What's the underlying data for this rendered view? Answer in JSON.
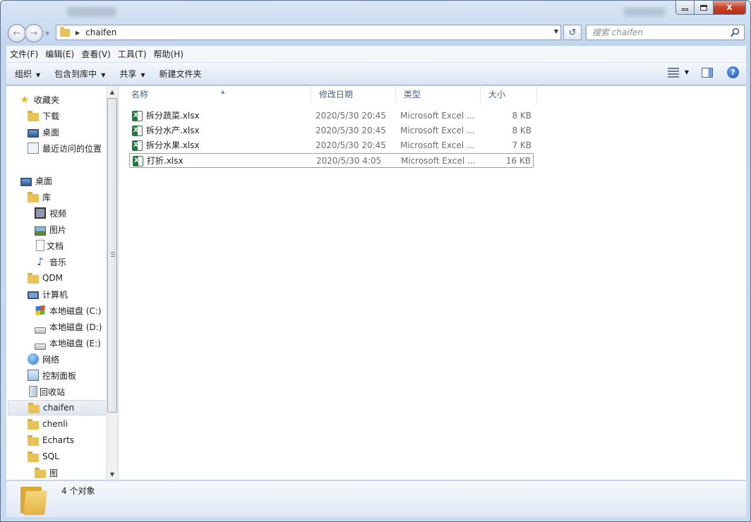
{
  "window": {
    "minimize_glyph": "",
    "close_glyph": "x"
  },
  "nav": {
    "back_glyph": "←",
    "forward_glyph": "→"
  },
  "address": {
    "path": "chaifen",
    "refresh_glyph": "↺"
  },
  "search": {
    "placeholder": "搜索 chaifen"
  },
  "menu": {
    "items": [
      "文件(F)",
      "编辑(E)",
      "查看(V)",
      "工具(T)",
      "帮助(H)"
    ]
  },
  "commands": {
    "items": [
      "组织",
      "包含到库中",
      "共享",
      "新建文件夹"
    ],
    "help_glyph": "?"
  },
  "sidebar": {
    "items": [
      {
        "label": "收藏夹",
        "icon": "star-icon"
      },
      {
        "label": "下载",
        "icon": "download-folder-icon"
      },
      {
        "label": "桌面",
        "icon": "desktop-icon"
      },
      {
        "label": "最近访问的位置",
        "icon": "recent-places-icon"
      },
      {
        "label": "桌面",
        "icon": "desktop-icon"
      },
      {
        "label": "库",
        "icon": "library-icon"
      },
      {
        "label": "视频",
        "icon": "video-icon"
      },
      {
        "label": "图片",
        "icon": "picture-icon"
      },
      {
        "label": "文档",
        "icon": "document-icon"
      },
      {
        "label": "音乐",
        "icon": "music-icon"
      },
      {
        "label": "QDM",
        "icon": "user-folder-icon"
      },
      {
        "label": "计算机",
        "icon": "computer-icon"
      },
      {
        "label": "本地磁盘 (C:)",
        "icon": "system-drive-icon"
      },
      {
        "label": "本地磁盘 (D:)",
        "icon": "drive-icon"
      },
      {
        "label": "本地磁盘 (E:)",
        "icon": "drive-icon"
      },
      {
        "label": "网络",
        "icon": "network-icon"
      },
      {
        "label": "控制面板",
        "icon": "control-panel-icon"
      },
      {
        "label": "回收站",
        "icon": "recycle-bin-icon"
      },
      {
        "label": "chaifen",
        "icon": "folder-icon"
      },
      {
        "label": "chenli",
        "icon": "folder-icon"
      },
      {
        "label": "Echarts",
        "icon": "folder-icon"
      },
      {
        "label": "SQL",
        "icon": "folder-icon"
      },
      {
        "label": "图",
        "icon": "folder-icon"
      }
    ],
    "selected": "chaifen",
    "scroll_up_glyph": "▲",
    "scroll_down_glyph": "▼"
  },
  "columns": {
    "name": "名称",
    "date": "修改日期",
    "type": "类型",
    "size": "大小",
    "sort_glyph": "▲"
  },
  "files": [
    {
      "name": "拆分蔬菜.xlsx",
      "date": "2020/5/30 20:45",
      "type": "Microsoft Excel ...",
      "size": "8 KB"
    },
    {
      "name": "拆分水产.xlsx",
      "date": "2020/5/30 20:45",
      "type": "Microsoft Excel ...",
      "size": "8 KB"
    },
    {
      "name": "拆分水果.xlsx",
      "date": "2020/5/30 20:45",
      "type": "Microsoft Excel ...",
      "size": "7 KB"
    },
    {
      "name": "打折.xlsx",
      "date": "2020/5/30 4:05",
      "type": "Microsoft Excel ...",
      "size": "16 KB"
    }
  ],
  "file_icon_letter": "X",
  "status": {
    "count": "4 个对象"
  }
}
